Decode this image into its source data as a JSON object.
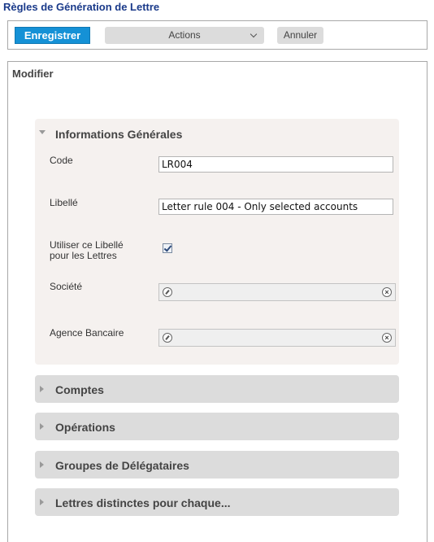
{
  "page": {
    "title": "Règles de Génération de Lettre"
  },
  "toolbar": {
    "save_label": "Enregistrer",
    "actions_label": "Actions",
    "cancel_label": "Annuler"
  },
  "panel": {
    "title": "Modifier"
  },
  "general": {
    "title": "Informations Générales",
    "code_label": "Code",
    "code_value": "LR004",
    "libelle_label": "Libellé",
    "libelle_value": "Letter rule 004 - Only selected accounts",
    "use_libelle_label_line1": "Utiliser ce Libellé",
    "use_libelle_label_line2": "pour les Lettres",
    "use_libelle_checked": true,
    "societe_label": "Société",
    "societe_value": "",
    "agence_label": "Agence Bancaire",
    "agence_value": ""
  },
  "sections": [
    {
      "label": "Comptes"
    },
    {
      "label": "Opérations"
    },
    {
      "label": "Groupes de Délégataires"
    },
    {
      "label": "Lettres distinctes pour chaque..."
    }
  ],
  "icons": {
    "expanded": "triangle-down-icon",
    "collapsed": "triangle-right-icon",
    "lookup": "search-picker-icon",
    "clear": "clear-icon"
  },
  "colors": {
    "title": "#1a3a8a",
    "save_button": "#1591d6",
    "section_open_bg": "#f5f1ef",
    "section_closed_bg": "#dcdcdc"
  }
}
